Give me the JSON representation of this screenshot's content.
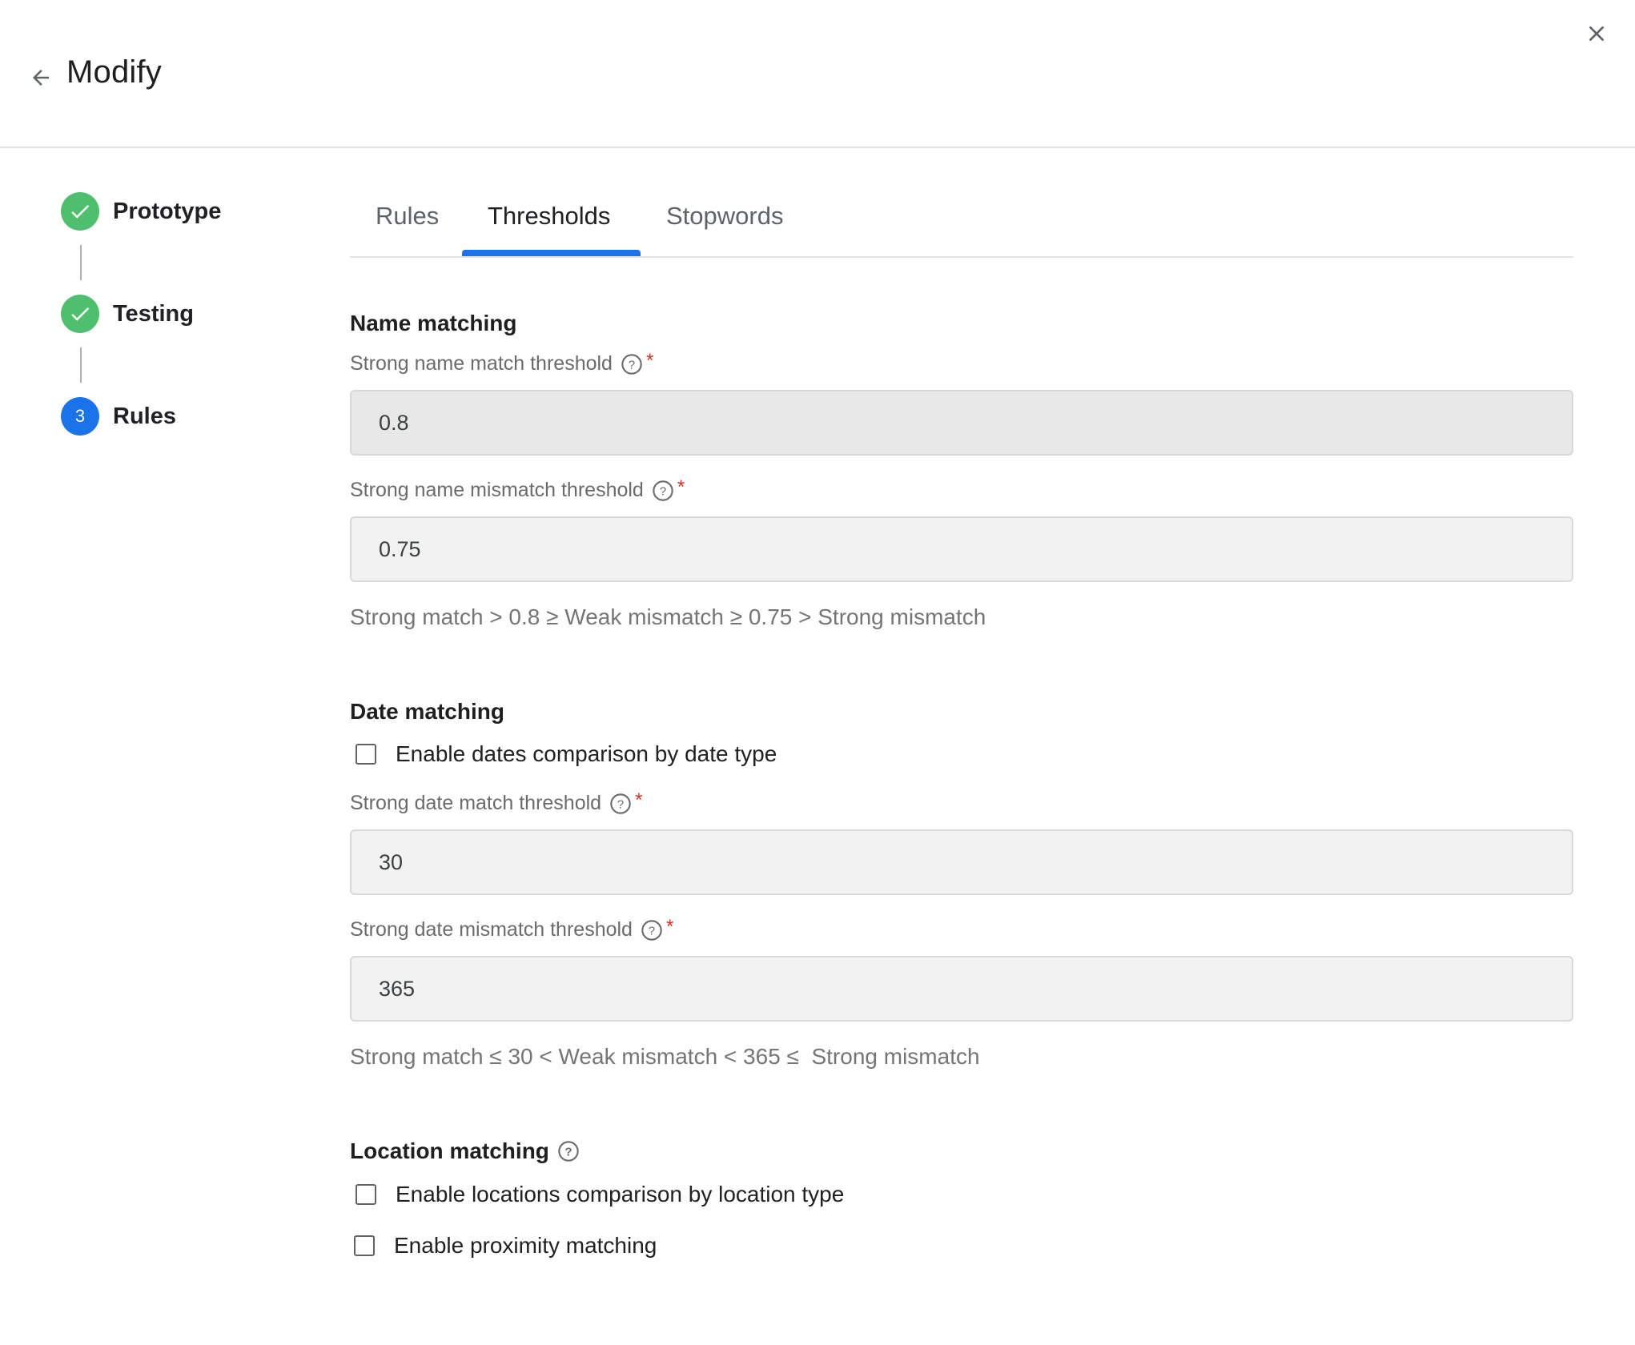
{
  "header": {
    "title": "Modify"
  },
  "stepper": {
    "steps": [
      {
        "label": "Prototype",
        "status": "done"
      },
      {
        "label": "Testing",
        "status": "done"
      },
      {
        "label": "Rules",
        "status": "active",
        "number": "3"
      }
    ]
  },
  "tabs": [
    {
      "label": "Rules",
      "active": false
    },
    {
      "label": "Thresholds",
      "active": true
    },
    {
      "label": "Stopwords",
      "active": false
    }
  ],
  "name_matching": {
    "title": "Name matching",
    "strong_match_label": "Strong name match threshold",
    "strong_match_value": "0.8",
    "strong_mismatch_label": "Strong name mismatch threshold",
    "strong_mismatch_value": "0.75",
    "hint": "Strong match > 0.8 ≥ Weak mismatch ≥ 0.75 > Strong mismatch"
  },
  "date_matching": {
    "title": "Date matching",
    "checkbox_label": "Enable dates comparison by date type",
    "checkbox_checked": false,
    "strong_match_label": "Strong date match threshold",
    "strong_match_value": "30",
    "strong_mismatch_label": "Strong date mismatch threshold",
    "strong_mismatch_value": "365",
    "hint": "Strong match ≤ 30 < Weak mismatch < 365 ≤  Strong mismatch"
  },
  "location_matching": {
    "title": "Location matching",
    "checkbox_label": "Enable locations comparison by location type",
    "checkbox_checked": false,
    "proximity_label": "Enable proximity matching",
    "proximity_checked": false
  },
  "required_marker": "*",
  "colors": {
    "accent": "#1a73e8",
    "success": "#4dbf6e",
    "required": "#d93025"
  }
}
